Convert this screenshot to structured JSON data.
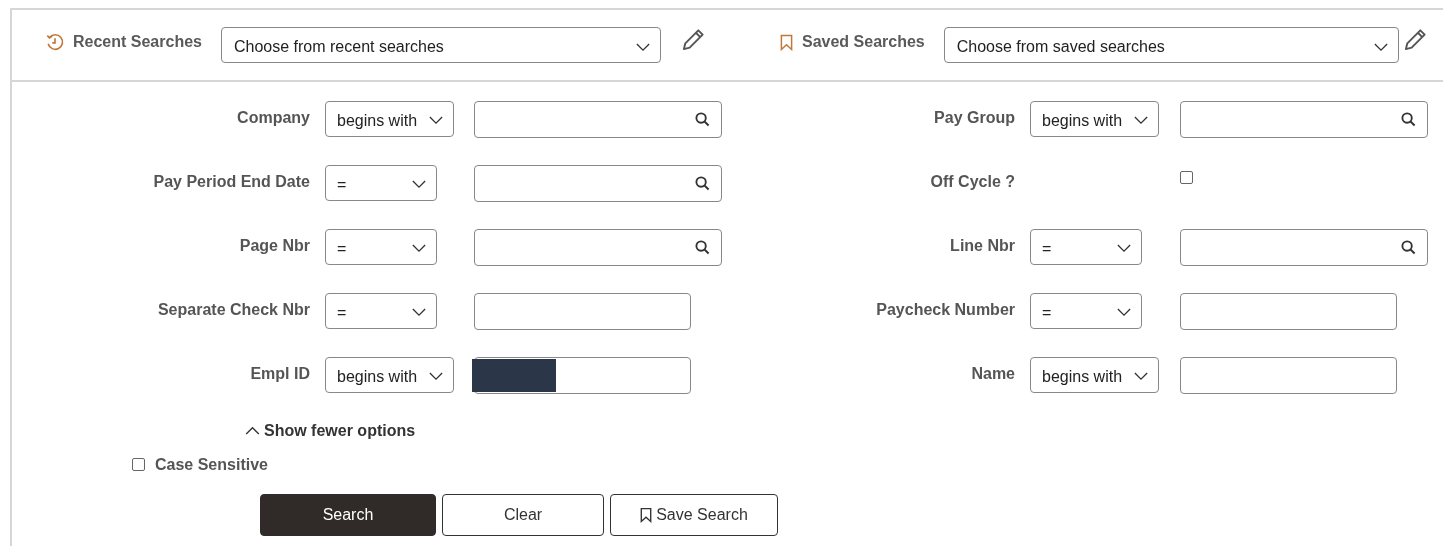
{
  "header": {
    "recent": {
      "label": "Recent Searches",
      "placeholder": "Choose from recent searches"
    },
    "saved": {
      "label": "Saved Searches",
      "placeholder": "Choose from saved searches"
    }
  },
  "rows": [
    {
      "left": {
        "kind": "lookup",
        "label": "Company",
        "operator": "begins with"
      },
      "right": {
        "kind": "lookup",
        "label": "Pay Group",
        "operator": "begins with"
      }
    },
    {
      "left": {
        "kind": "lookup",
        "label": "Pay Period End Date",
        "operator": "="
      },
      "right": {
        "kind": "checkbox",
        "label": "Off Cycle ?",
        "checked": false
      }
    },
    {
      "left": {
        "kind": "lookup",
        "label": "Page Nbr",
        "operator": "="
      },
      "right": {
        "kind": "lookup",
        "label": "Line Nbr",
        "operator": "="
      }
    },
    {
      "left": {
        "kind": "text",
        "label": "Separate Check Nbr",
        "operator": "=",
        "redacted": false
      },
      "right": {
        "kind": "text",
        "label": "Paycheck Number",
        "operator": "=",
        "redacted": false
      }
    },
    {
      "left": {
        "kind": "text",
        "label": "Empl ID",
        "operator": "begins with",
        "redacted": true
      },
      "right": {
        "kind": "text",
        "label": "Name",
        "operator": "begins with",
        "redacted": false
      }
    }
  ],
  "toggle": {
    "label": "Show fewer options",
    "expanded": true
  },
  "case_sensitive": {
    "label": "Case Sensitive",
    "checked": false
  },
  "buttons": [
    {
      "kind": "primary",
      "label": "Search"
    },
    {
      "kind": "secondary",
      "label": "Clear"
    },
    {
      "kind": "save",
      "label": "Save Search"
    }
  ]
}
